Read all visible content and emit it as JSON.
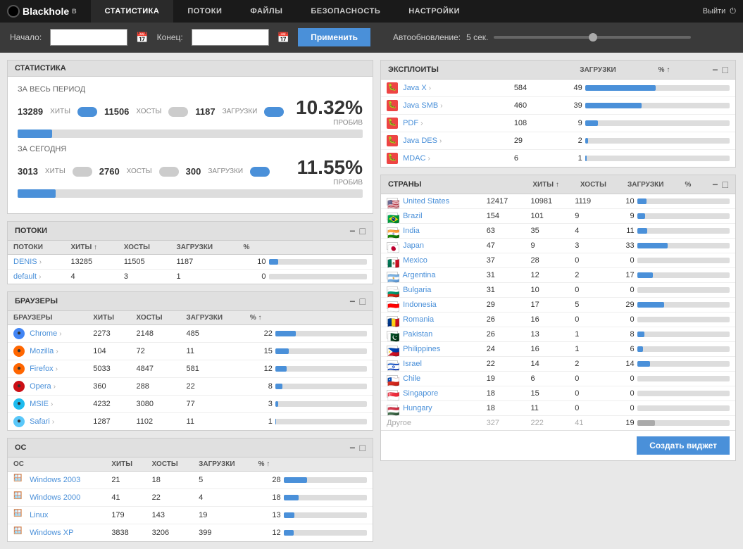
{
  "app": {
    "logo": "Blackhole",
    "logo_sup": "B",
    "logout_label": "Выйти"
  },
  "nav": {
    "items": [
      {
        "id": "stats",
        "label": "СТАТИСТИКА",
        "active": true
      },
      {
        "id": "streams",
        "label": "ПОТОКИ"
      },
      {
        "id": "files",
        "label": "ФАЙЛЫ"
      },
      {
        "id": "security",
        "label": "БЕЗОПАСНОСТЬ"
      },
      {
        "id": "settings",
        "label": "НАСТРОЙКИ"
      }
    ]
  },
  "filterbar": {
    "start_label": "Начало:",
    "end_label": "Конец:",
    "apply_label": "Применить",
    "autoupdate_label": "Автообновление:",
    "autoupdate_value": "5 сек."
  },
  "statistics": {
    "section_title": "СТАТИСТИКА",
    "period_label": "ЗА ВЕСЬ ПЕРИОД",
    "today_label": "ЗА СЕГОДНЯ",
    "period_hits": "13289",
    "period_hits_label": "ХИТЫ",
    "period_hosts": "11506",
    "period_hosts_label": "ХОСТЫ",
    "period_downloads": "1187",
    "period_downloads_label": "ЗАГРУЗКИ",
    "period_pct": "10.32%",
    "period_pct_label": "ПРОБИВ",
    "period_bar_pct": 10,
    "today_hits": "3013",
    "today_hits_label": "ХИТЫ",
    "today_hosts": "2760",
    "today_hosts_label": "ХОСТЫ",
    "today_downloads": "300",
    "today_downloads_label": "ЗАГРУЗКИ",
    "today_pct": "11.55%",
    "today_pct_label": "ПРОБИВ",
    "today_bar_pct": 11
  },
  "streams": {
    "section_title": "ПОТОКИ",
    "col_hits": "ХИТЫ ↑",
    "col_hosts": "ХОСТЫ",
    "col_downloads": "ЗАГРУЗКИ",
    "col_pct": "%",
    "rows": [
      {
        "name": "DENIS",
        "hits": "13285",
        "hosts": "11505",
        "downloads": "1187",
        "pct": "10.32",
        "bar": 10
      },
      {
        "name": "default",
        "hits": "4",
        "hosts": "3",
        "downloads": "1",
        "pct": "0.00",
        "bar": 0
      }
    ]
  },
  "browsers": {
    "section_title": "БРАУЗЕРЫ",
    "col_hits": "ХИТЫ",
    "col_hosts": "ХОСТЫ",
    "col_downloads": "ЗАГРУЗКИ",
    "col_pct": "% ↑",
    "rows": [
      {
        "name": "Chrome",
        "icon_color": "#4285F4",
        "hits": "2273",
        "hosts": "2148",
        "downloads": "485",
        "pct": "22.58",
        "bar": 22
      },
      {
        "name": "Mozilla",
        "icon_color": "#FF6600",
        "hits": "104",
        "hosts": "72",
        "downloads": "11",
        "pct": "15.71",
        "bar": 15
      },
      {
        "name": "Firefox",
        "icon_color": "#FF6600",
        "hits": "5033",
        "hosts": "4847",
        "downloads": "581",
        "pct": "11.99",
        "bar": 12
      },
      {
        "name": "Opera",
        "icon_color": "#CC0F16",
        "hits": "360",
        "hosts": "288",
        "downloads": "22",
        "pct": "7.75",
        "bar": 8
      },
      {
        "name": "MSIE",
        "icon_color": "#1EBBEE",
        "hits": "4232",
        "hosts": "3080",
        "downloads": "77",
        "pct": "2.51",
        "bar": 3
      },
      {
        "name": "Safari",
        "icon_color": "#5AC8FA",
        "hits": "1287",
        "hosts": "1102",
        "downloads": "11",
        "pct": "1.00",
        "bar": 1
      }
    ]
  },
  "os": {
    "section_title": "ОС",
    "col_hits": "ХИТЫ",
    "col_hosts": "ХОСТЫ",
    "col_downloads": "ЗАГРУЗКИ",
    "col_pct": "% ↑",
    "rows": [
      {
        "name": "Windows 2003",
        "hits": "21",
        "hosts": "18",
        "downloads": "5",
        "pct": "27.78",
        "bar": 28
      },
      {
        "name": "Windows 2000",
        "hits": "41",
        "hosts": "22",
        "downloads": "4",
        "pct": "18.18",
        "bar": 18
      },
      {
        "name": "Linux",
        "hits": "179",
        "hosts": "143",
        "downloads": "19",
        "pct": "13.48",
        "bar": 13
      },
      {
        "name": "Windows XP",
        "hits": "3838",
        "hosts": "3206",
        "downloads": "399",
        "pct": "12.48",
        "bar": 12
      }
    ]
  },
  "exploits": {
    "section_title": "ЭКСПЛОИТЫ",
    "col_downloads": "ЗАГРУЗКИ",
    "col_pct": "% ↑",
    "rows": [
      {
        "name": "Java X",
        "downloads": "584",
        "pct": "49.20",
        "bar": 49
      },
      {
        "name": "Java SMB",
        "downloads": "460",
        "pct": "38.75",
        "bar": 39
      },
      {
        "name": "PDF",
        "downloads": "108",
        "pct": "9.10",
        "bar": 9
      },
      {
        "name": "Java DES",
        "downloads": "29",
        "pct": "2.44",
        "bar": 2
      },
      {
        "name": "MDAC",
        "downloads": "6",
        "pct": "0.51",
        "bar": 1
      }
    ]
  },
  "countries": {
    "section_title": "СТРАНЫ",
    "col_hits": "ХИТЫ ↑",
    "col_hosts": "ХОСТЫ",
    "col_downloads": "ЗАГРУЗКИ",
    "col_pct": "%",
    "rows": [
      {
        "name": "United States",
        "flag": "🇺🇸",
        "hits": "12417",
        "hosts": "10981",
        "downloads": "1119",
        "pct": "10.19",
        "bar": 10
      },
      {
        "name": "Brazil",
        "flag": "🇧🇷",
        "hits": "154",
        "hosts": "101",
        "downloads": "9",
        "pct": "8.91",
        "bar": 9
      },
      {
        "name": "India",
        "flag": "🇮🇳",
        "hits": "63",
        "hosts": "35",
        "downloads": "4",
        "pct": "11.43",
        "bar": 11
      },
      {
        "name": "Japan",
        "flag": "🇯🇵",
        "hits": "47",
        "hosts": "9",
        "downloads": "3",
        "pct": "33.33",
        "bar": 33
      },
      {
        "name": "Mexico",
        "flag": "🇲🇽",
        "hits": "37",
        "hosts": "28",
        "downloads": "0",
        "pct": "0.00",
        "bar": 0
      },
      {
        "name": "Argentina",
        "flag": "🇦🇷",
        "hits": "31",
        "hosts": "12",
        "downloads": "2",
        "pct": "16.67",
        "bar": 17
      },
      {
        "name": "Bulgaria",
        "flag": "🇧🇬",
        "hits": "31",
        "hosts": "10",
        "downloads": "0",
        "pct": "0.00",
        "bar": 0
      },
      {
        "name": "Indonesia",
        "flag": "🇮🇩",
        "hits": "29",
        "hosts": "17",
        "downloads": "5",
        "pct": "29.41",
        "bar": 29
      },
      {
        "name": "Romania",
        "flag": "🇷🇴",
        "hits": "26",
        "hosts": "16",
        "downloads": "0",
        "pct": "0.00",
        "bar": 0
      },
      {
        "name": "Pakistan",
        "flag": "🇵🇰",
        "hits": "26",
        "hosts": "13",
        "downloads": "1",
        "pct": "7.69",
        "bar": 8
      },
      {
        "name": "Philippines",
        "flag": "🇵🇭",
        "hits": "24",
        "hosts": "16",
        "downloads": "1",
        "pct": "6.25",
        "bar": 6
      },
      {
        "name": "Israel",
        "flag": "🇮🇱",
        "hits": "22",
        "hosts": "14",
        "downloads": "2",
        "pct": "14.29",
        "bar": 14
      },
      {
        "name": "Chile",
        "flag": "🇨🇱",
        "hits": "19",
        "hosts": "6",
        "downloads": "0",
        "pct": "0.00",
        "bar": 0
      },
      {
        "name": "Singapore",
        "flag": "🇸🇬",
        "hits": "18",
        "hosts": "15",
        "downloads": "0",
        "pct": "0.00",
        "bar": 0
      },
      {
        "name": "Hungary",
        "flag": "🇭🇺",
        "hits": "18",
        "hosts": "11",
        "downloads": "0",
        "pct": "0.00",
        "bar": 0
      },
      {
        "name": "Другое",
        "flag": "",
        "hits": "327",
        "hosts": "222",
        "downloads": "41",
        "pct": "18.55",
        "bar": 19,
        "dimmed": true
      }
    ]
  },
  "widget": {
    "create_label": "Создать виджет"
  }
}
